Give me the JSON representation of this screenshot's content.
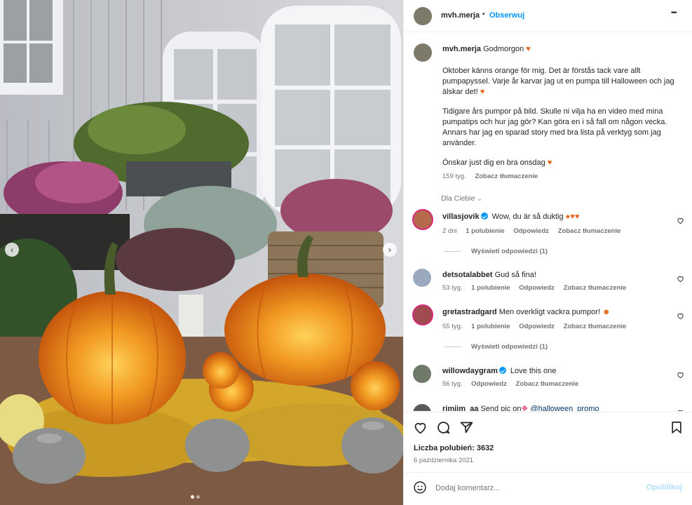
{
  "post": {
    "username": "mvh.merja",
    "follow": "Obserwuj",
    "more": "•••",
    "dot": "•"
  },
  "caption": {
    "username": "mvh.merja",
    "text_line1": "Godmorgon",
    "paragraph1": "Oktober känns orange för mig. Det är förstås tack vare allt pumpapyssel. Varje år karvar jag ut en pumpa till Halloween och jag älskar det!",
    "paragraph2": "Tidigare års pumpor på bild. Skulle ni vilja ha en video med mina pumpatips och hur jag gör? Kan göra en i så fall om någon vecka. Annars har jag en sparad story med bra lista på verktyg som jag använder.",
    "paragraph3": "Önskar just dig en bra onsdag",
    "time": "159 tyg.",
    "translate": "Zobacz tłumaczenie"
  },
  "sort": "Dla Ciebie",
  "comments": [
    {
      "user": "villasjovik",
      "verified": true,
      "text": "Wow, du är så duktig",
      "time": "2 dni",
      "likes": "1 polubienie",
      "reply": "Odpowiedz",
      "translate": "Zobacz tłumaczenie",
      "replies": "Wyświetl odpowiedzi (1)"
    },
    {
      "user": "detsotalabbet",
      "verified": false,
      "text": "Gud så fina!",
      "time": "53 tyg.",
      "likes": "1 polubienie",
      "reply": "Odpowiedz",
      "translate": "Zobacz tłumaczenie"
    },
    {
      "user": "gretastradgard",
      "verified": false,
      "text": "Men overkligt vackra pumpor!",
      "time": "55 tyg.",
      "likes": "1 polubienie",
      "reply": "Odpowiedz",
      "translate": "Zobacz tłumaczenie",
      "replies": "Wyświetl odpowiedzi (1)"
    },
    {
      "user": "willowdaygram",
      "verified": true,
      "text": "Love this one",
      "time": "56 tyg.",
      "reply": "Odpowiedz",
      "translate": "Zobacz tłumaczenie"
    },
    {
      "user": "rimiim_aa",
      "verified": false,
      "text": "Send pic on",
      "mention": "@halloween_promo"
    }
  ],
  "likes": "Liczba polubień: 3632",
  "date": "6 października 2021",
  "add_comment": {
    "placeholder": "Dodaj komentarz...",
    "publish": "Opublikuj"
  },
  "colors": {
    "accent": "#0095f6",
    "heart": "#e8641b",
    "publish_disabled": "#b2dffc"
  }
}
